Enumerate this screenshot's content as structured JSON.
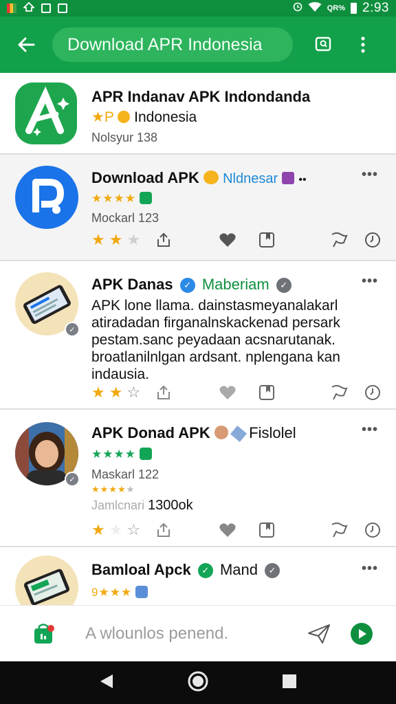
{
  "status_bar": {
    "time": "2:93",
    "battery_text": "QR%"
  },
  "app_bar": {
    "title": "Download APR Indonesia",
    "back_icon": "back-arrow-icon",
    "colors": {
      "bar": "#12a04a",
      "pill": "#2db45d",
      "status": "#0e8f3e"
    }
  },
  "items": [
    {
      "title": "APR Indanav APK Indondanda",
      "sub_prefix": "★P",
      "sub_text": "Indonesia",
      "meta": "Nolsyur 138",
      "icon": "letter-a-app-icon",
      "color": "#1ea64f"
    },
    {
      "title": "Download APK",
      "tag": "Nldnesar",
      "tag_extra": "••",
      "meta": "Mockarl 123",
      "rating_stars": "★★★★",
      "icon": "letter-p-app-icon",
      "color": "#1a73e8"
    },
    {
      "title": "APK Danas",
      "tag": "Maberiam",
      "text": "APK lone llama. dainstasmeyanalakarl atiradadan firganalnskackenad persark pestam.sanc peyadaan acsnarutanak. broatlanilnlgan ardsant. nplengana kan indausia.",
      "icon": "phone-app-icon"
    },
    {
      "title": "APK Donad APK",
      "tag": "Fislolel",
      "meta": "Maskarl 122",
      "meta2": "Jamlcnari",
      "count": "1300ok",
      "icon": "person-photo-avatar"
    },
    {
      "title": "Bamloal Apck",
      "tag": "Mand",
      "rating_prefix": "9★★★",
      "icon": "phone-app-icon"
    }
  ],
  "compose": {
    "placeholder": "A wlounlos penend."
  }
}
